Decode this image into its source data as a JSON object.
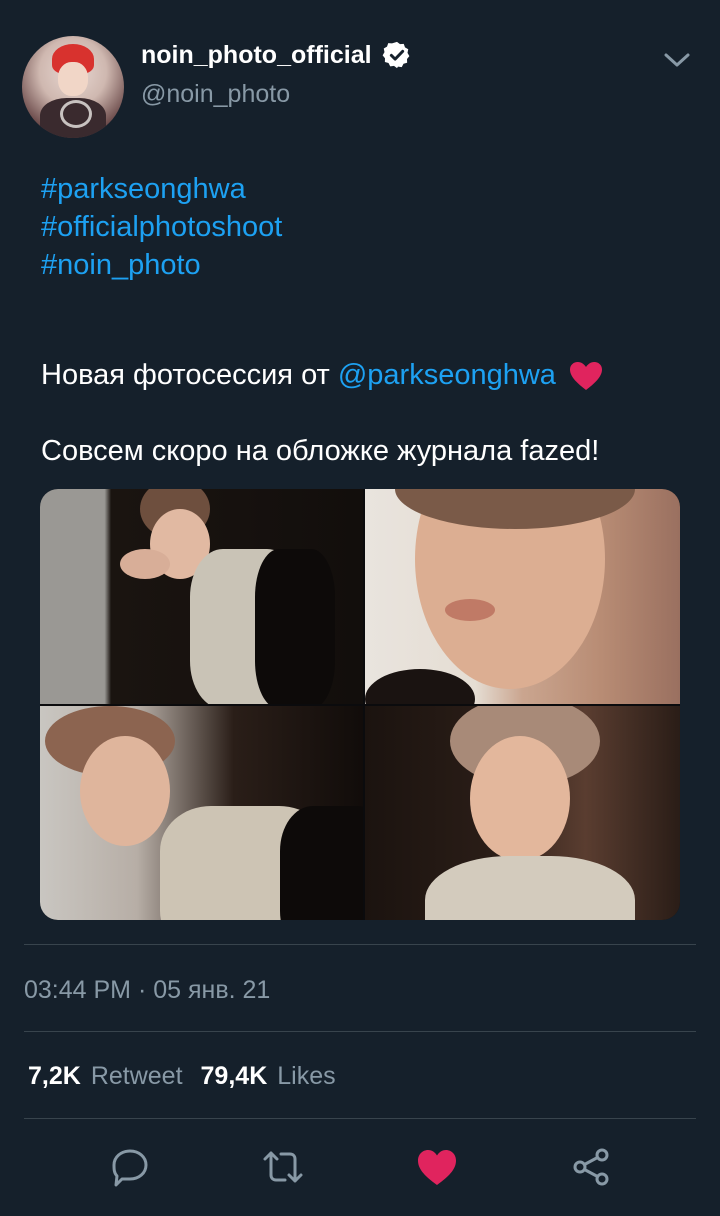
{
  "tweet": {
    "display_name": "noin_photo_official",
    "handle": "@noin_photo",
    "hashtags": [
      "#parkseonghwa",
      "#officialphotoshoot",
      "#noin_photo"
    ],
    "text_line1_prefix": "Новая фотосессия от",
    "text_line1_mention": "@parkseonghwa",
    "text_line2": "Совсем скоро на обложке журнала fazed!",
    "timestamp": "03:44 PM · 05 янв. 21",
    "retweet_count": "7,2K",
    "retweet_label": "Retweet",
    "like_count": "79,4K",
    "like_label": "Likes"
  },
  "icons": {
    "verified": "verified-badge-icon",
    "menu": "chevron-down-icon",
    "reply": "reply-icon",
    "retweet": "retweet-icon",
    "like": "heart-icon",
    "share": "share-icon"
  },
  "colors": {
    "background": "#15202b",
    "link": "#1da1f2",
    "secondary_text": "#8899a6",
    "like_active": "#e0245e"
  }
}
